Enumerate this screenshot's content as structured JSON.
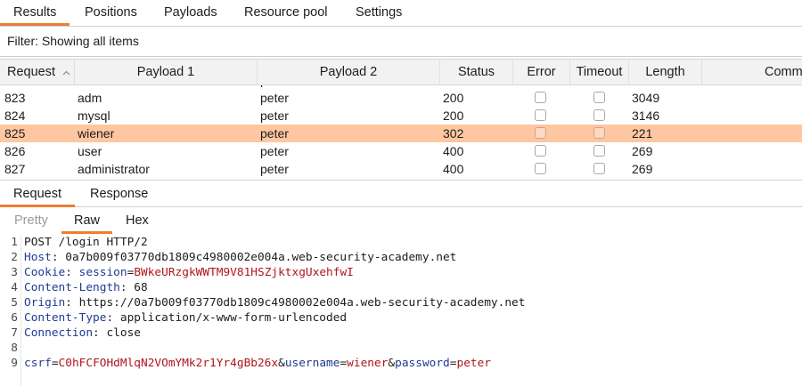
{
  "tabs": [
    "Results",
    "Positions",
    "Payloads",
    "Resource pool",
    "Settings"
  ],
  "filter": {
    "text": "Filter: Showing all items"
  },
  "table": {
    "headers": [
      "Request",
      "Payload 1",
      "Payload 2",
      "Status",
      "Error",
      "Timeout",
      "Length",
      "Comm"
    ],
    "sort_icon": "chevron-up-icon",
    "partial_row": [
      "",
      "",
      "peter",
      "",
      "",
      "",
      "",
      ""
    ],
    "rows": [
      {
        "request": "823",
        "payload1": "adm",
        "payload2": "peter",
        "status": "200",
        "error": false,
        "timeout": false,
        "length": "3049",
        "highlight": false
      },
      {
        "request": "824",
        "payload1": "mysql",
        "payload2": "peter",
        "status": "200",
        "error": false,
        "timeout": false,
        "length": "3146",
        "highlight": false
      },
      {
        "request": "825",
        "payload1": "wiener",
        "payload2": "peter",
        "status": "302",
        "error": false,
        "timeout": false,
        "length": "221",
        "highlight": true
      },
      {
        "request": "826",
        "payload1": "user",
        "payload2": "peter",
        "status": "400",
        "error": false,
        "timeout": false,
        "length": "269",
        "highlight": false
      },
      {
        "request": "827",
        "payload1": "administrator",
        "payload2": "peter",
        "status": "400",
        "error": false,
        "timeout": false,
        "length": "269",
        "highlight": false
      }
    ],
    "highlight_color": "#ffc7a1"
  },
  "message_tabs": [
    "Request",
    "Response"
  ],
  "view_tabs": [
    "Pretty",
    "Raw",
    "Hex"
  ],
  "editor": {
    "lines": [
      {
        "n": "1",
        "segments": [
          {
            "t": "POST /login HTTP/2",
            "c": "plain"
          }
        ]
      },
      {
        "n": "2",
        "segments": [
          {
            "t": "Host",
            "c": "hk"
          },
          {
            "t": ": 0a7b009f03770db1809c4980002e004a.web-security-academy.net",
            "c": "plain"
          }
        ]
      },
      {
        "n": "3",
        "segments": [
          {
            "t": "Cookie",
            "c": "hk"
          },
          {
            "t": ": ",
            "c": "plain"
          },
          {
            "t": "session",
            "c": "hk"
          },
          {
            "t": "=",
            "c": "plain"
          },
          {
            "t": "BWkeURzgkWWTM9V81HSZjktxgUxehfwI",
            "c": "red"
          }
        ]
      },
      {
        "n": "4",
        "segments": [
          {
            "t": "Content-Length",
            "c": "hk"
          },
          {
            "t": ": 68",
            "c": "plain"
          }
        ]
      },
      {
        "n": "5",
        "segments": [
          {
            "t": "Origin",
            "c": "hk"
          },
          {
            "t": ": https://0a7b009f03770db1809c4980002e004a.web-security-academy.net",
            "c": "plain"
          }
        ]
      },
      {
        "n": "6",
        "segments": [
          {
            "t": "Content-Type",
            "c": "hk"
          },
          {
            "t": ": application/x-www-form-urlencoded",
            "c": "plain"
          }
        ]
      },
      {
        "n": "7",
        "segments": [
          {
            "t": "Connection",
            "c": "hk"
          },
          {
            "t": ": close",
            "c": "plain"
          }
        ]
      },
      {
        "n": "8",
        "segments": []
      },
      {
        "n": "9",
        "segments": [
          {
            "t": "csrf",
            "c": "hk"
          },
          {
            "t": "=",
            "c": "plain"
          },
          {
            "t": "C0hFCFOHdMlqN2VOmYMk2r1Yr4gBb26x",
            "c": "red"
          },
          {
            "t": "&",
            "c": "plain"
          },
          {
            "t": "username",
            "c": "hk"
          },
          {
            "t": "=",
            "c": "plain"
          },
          {
            "t": "wiener",
            "c": "red"
          },
          {
            "t": "&",
            "c": "plain"
          },
          {
            "t": "password",
            "c": "hk"
          },
          {
            "t": "=",
            "c": "plain"
          },
          {
            "t": "peter",
            "c": "red"
          }
        ]
      }
    ]
  },
  "accent_color": "#ed7d31"
}
